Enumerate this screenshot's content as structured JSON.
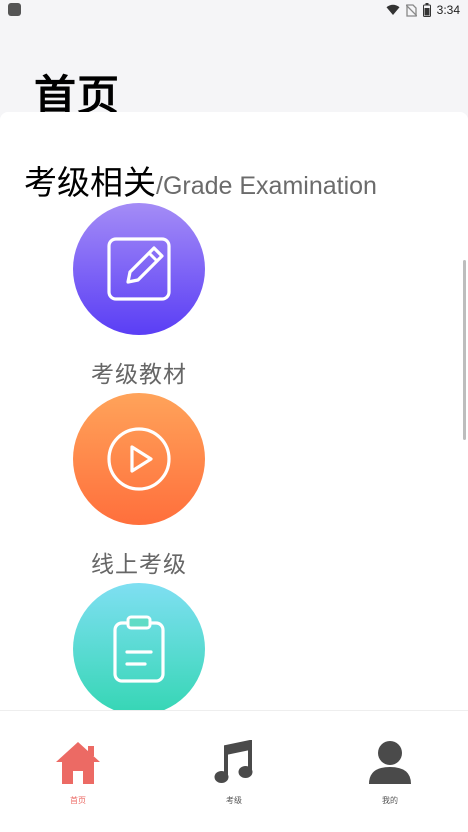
{
  "status_bar": {
    "time": "3:34",
    "icons": [
      "app-notification-icon",
      "wifi-icon",
      "no-sim-icon",
      "battery-icon"
    ]
  },
  "header": {
    "title": "首页"
  },
  "section": {
    "title_zh": "考级相关",
    "title_en": "/Grade Examination"
  },
  "features": [
    {
      "label": "考级教材",
      "icon": "edit-icon",
      "color_top": "#a48cf6",
      "color_bottom": "#5a3ef5"
    },
    {
      "label": "线上考级",
      "icon": "play-icon",
      "color_top": "#ffa35a",
      "color_bottom": "#ff6f3c"
    },
    {
      "label": "",
      "icon": "clipboard-icon",
      "color_top": "#7fdff2",
      "color_bottom": "#35d6b4"
    }
  ],
  "bottom_nav": {
    "items": [
      {
        "label": "首页",
        "icon": "home-icon",
        "active": true,
        "color": "#ec6a64"
      },
      {
        "label": "考级",
        "icon": "music-note-icon",
        "active": false,
        "color": "#4a4a4a"
      },
      {
        "label": "我的",
        "icon": "user-icon",
        "active": false,
        "color": "#4a4a4a"
      }
    ]
  }
}
